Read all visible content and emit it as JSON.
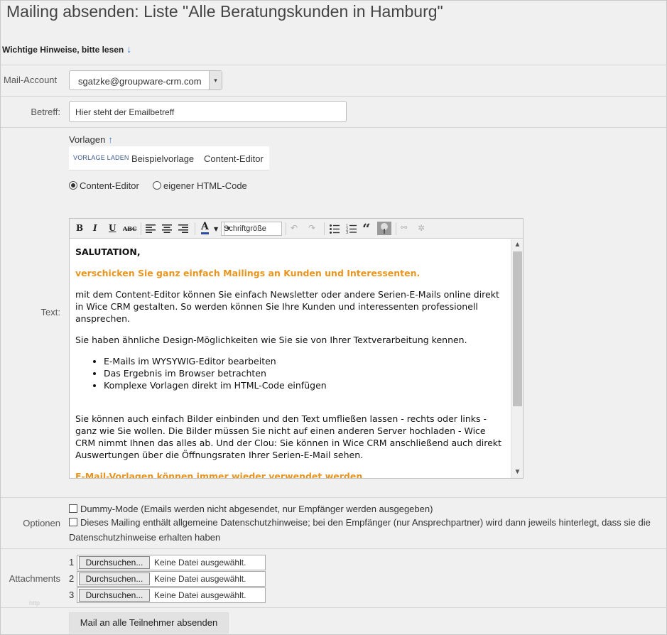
{
  "page": {
    "title": "Mailing absenden: Liste \"Alle Beratungskunden in Hamburg\""
  },
  "hint": {
    "label": "Wichtige Hinweise, bitte lesen",
    "arrow": "↓"
  },
  "labels": {
    "mail_account": "Mail-Account",
    "betreff": "Betreff:",
    "text": "Text:",
    "optionen": "Optionen",
    "attachments": "Attachments"
  },
  "mail_account": {
    "value": "sgatzke@groupware-crm.com",
    "dropdown": "▾"
  },
  "betreff": {
    "value": "Hier steht der Emailbetreff"
  },
  "vorlagen": {
    "label": "Vorlagen",
    "arrow": "↑",
    "load_label": "VORLAGE LADEN",
    "items": [
      "Beispielvorlage",
      "Content-Editor"
    ]
  },
  "mode": {
    "content_editor": "Content-Editor",
    "html_code": "eigener HTML-Code",
    "selected": "content_editor"
  },
  "toolbar": {
    "bold": "B",
    "italic": "I",
    "underline": "U",
    "strike": "ABC",
    "font_color": "A",
    "font_size": "Schriftgröße",
    "quote": "“"
  },
  "editor": {
    "salutation": "SALUTATION,",
    "headline": "verschicken Sie ganz einfach Mailings an Kunden und Interessenten.",
    "para1": "mit dem Content-Editor können Sie einfach Newsletter oder andere Serien-E-Mails online direkt in Wice CRM gestalten. So werden können Sie Ihre Kunden und interessenten professionell ansprechen.",
    "para2": "Sie haben ähnliche Design-Möglichkeiten wie Sie sie von Ihrer Textverarbeitung kennen.",
    "bullets": [
      "E-Mails im WYSYWIG-Editor bearbeiten",
      "Das Ergebnis im Browser betrachten",
      "Komplexe Vorlagen direkt im HTML-Code einfügen"
    ],
    "para3": "Sie können auch einfach Bilder einbinden und den Text umfließen lassen - rechts oder links - ganz wie Sie wollen. Die Bilder müssen Sie nicht auf einen anderen Server hochladen - Wice CRM nimmt Ihnen das alles ab. Und der Clou: Sie können in Wice CRM anschließend auch direkt Auswertungen über die Öffnungsraten Ihrer Serien-E-Mail sehen.",
    "headline2": "E-Mail-Vorlagen können immer wieder verwendet werden"
  },
  "options": {
    "dummy": "Dummy-Mode (Emails werden nicht abgesendet, nur Empfänger werden ausgegeben)",
    "privacy": "Dieses Mailing enthält allgemeine Datenschutzhinweise; bei den Empfänger (nur Ansprechpartner) wird dann jeweils hinterlegt, dass sie die",
    "privacy_cont": "Datenschutzhinweise erhalten haben"
  },
  "attachments": [
    {
      "num": "1",
      "button": "Durchsuchen...",
      "status": "Keine Datei ausgewählt."
    },
    {
      "num": "2",
      "button": "Durchsuchen...",
      "status": "Keine Datei ausgewählt."
    },
    {
      "num": "3",
      "button": "Durchsuchen...",
      "status": "Keine Datei ausgewählt."
    }
  ],
  "http_label": "http",
  "submit": {
    "label": "Mail an alle Teilnehmer absenden"
  }
}
